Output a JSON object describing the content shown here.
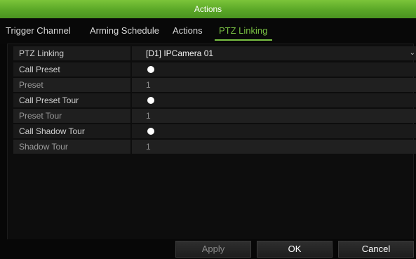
{
  "window": {
    "title": "Actions"
  },
  "tabs": [
    {
      "label": "Trigger Channel",
      "active": false
    },
    {
      "label": "Arming Schedule",
      "active": false
    },
    {
      "label": "Actions",
      "active": false
    },
    {
      "label": "PTZ Linking",
      "active": true
    }
  ],
  "form": {
    "ptz_linking": {
      "label": "PTZ Linking",
      "value": "[D1] IPCamera 01"
    },
    "call_preset": {
      "label": "Call Preset",
      "enabled": true
    },
    "preset": {
      "label": "Preset",
      "value": "1"
    },
    "call_preset_tour": {
      "label": "Call Preset Tour",
      "enabled": true
    },
    "preset_tour": {
      "label": "Preset Tour",
      "value": "1"
    },
    "call_shadow_tour": {
      "label": "Call Shadow Tour",
      "enabled": true
    },
    "shadow_tour": {
      "label": "Shadow Tour",
      "value": "1"
    }
  },
  "buttons": {
    "apply": "Apply",
    "ok": "OK",
    "cancel": "Cancel"
  },
  "colors": {
    "accent": "#7ac143",
    "titlebar": "#5aa727"
  },
  "icons": {
    "dropdown": "chevron-down-icon",
    "radio": "radio-selected-icon"
  }
}
